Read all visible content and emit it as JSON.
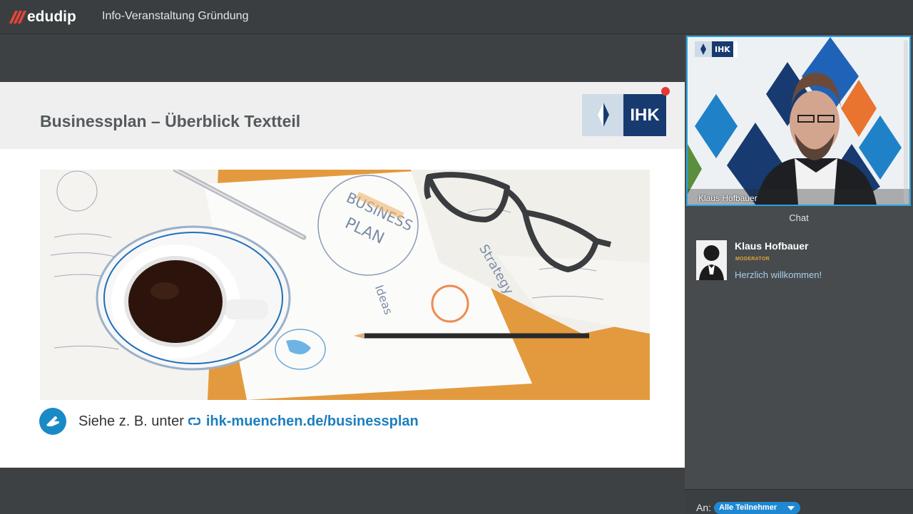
{
  "app": {
    "brand": "edudip",
    "event_title": "Info-Veranstaltung Gründung"
  },
  "slide": {
    "title": "Businessplan – Überblick Textteil",
    "logo_text": "IHK",
    "link_prefix": "Siehe z. B. unter",
    "link_url": "ihk-muenchen.de/businessplan",
    "photo_words": [
      "BUSINESS",
      "PLAN",
      "Strategy",
      "Ideas"
    ]
  },
  "video": {
    "presenter_name": "Klaus Hofbauer",
    "logo_text": "IHK"
  },
  "chat": {
    "title": "Chat",
    "messages": [
      {
        "name": "Klaus Hofbauer",
        "role": "MODERATOR",
        "text": "Herzlich willkommen!"
      }
    ],
    "to_label": "An:",
    "recipient": "Alle Teilnehmer"
  },
  "colors": {
    "brand_red": "#e8443a",
    "accent_blue": "#1e88d3",
    "ihk_navy": "#173b70",
    "link_blue": "#1c7fbf"
  }
}
